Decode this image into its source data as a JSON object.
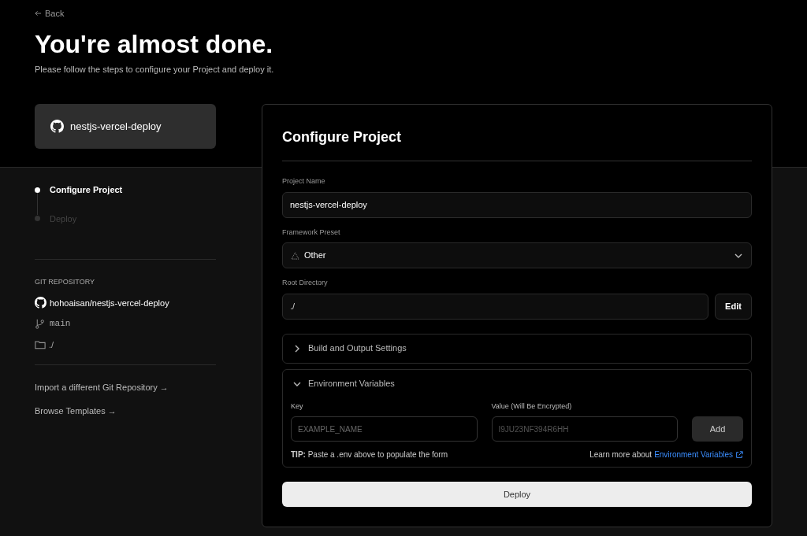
{
  "back": {
    "label": "Back"
  },
  "heading": {
    "title": "You're almost done.",
    "subtitle": "Please follow the steps to configure your Project and deploy it."
  },
  "repo_card": {
    "name": "nestjs-vercel-deploy"
  },
  "steps": [
    {
      "label": "Configure Project",
      "selected": true
    },
    {
      "label": "Deploy",
      "selected": false
    }
  ],
  "git_repository": {
    "heading": "GIT REPOSITORY",
    "repo": "hohoaisan/nestjs-vercel-deploy",
    "branch": "main",
    "directory": "./"
  },
  "links": [
    "Import a different Git Repository →",
    "Browse Templates →"
  ],
  "configure": {
    "title": "Configure Project",
    "project_name": {
      "label": "Project Name",
      "value": "nestjs-vercel-deploy"
    },
    "framework_preset": {
      "label": "Framework Preset",
      "value": "Other"
    },
    "root_directory": {
      "label": "Root Directory",
      "value": "./",
      "button": "Edit"
    },
    "sections": [
      {
        "title": "Build and Output Settings",
        "expanded": false
      },
      {
        "title": "Environment Variables",
        "expanded": true
      }
    ],
    "env": {
      "key_label": "Key",
      "key_placeholder": "EXAMPLE_NAME",
      "value_label": "Value (Will Be Encrypted)",
      "value_placeholder": "I9JU23NF394R6HH",
      "add": "Add",
      "tip": "**TIP:** Paste a .env above to populate the form",
      "learn_more": "Learn more about",
      "link": "Environment Variables"
    },
    "deploy": "Deploy"
  }
}
